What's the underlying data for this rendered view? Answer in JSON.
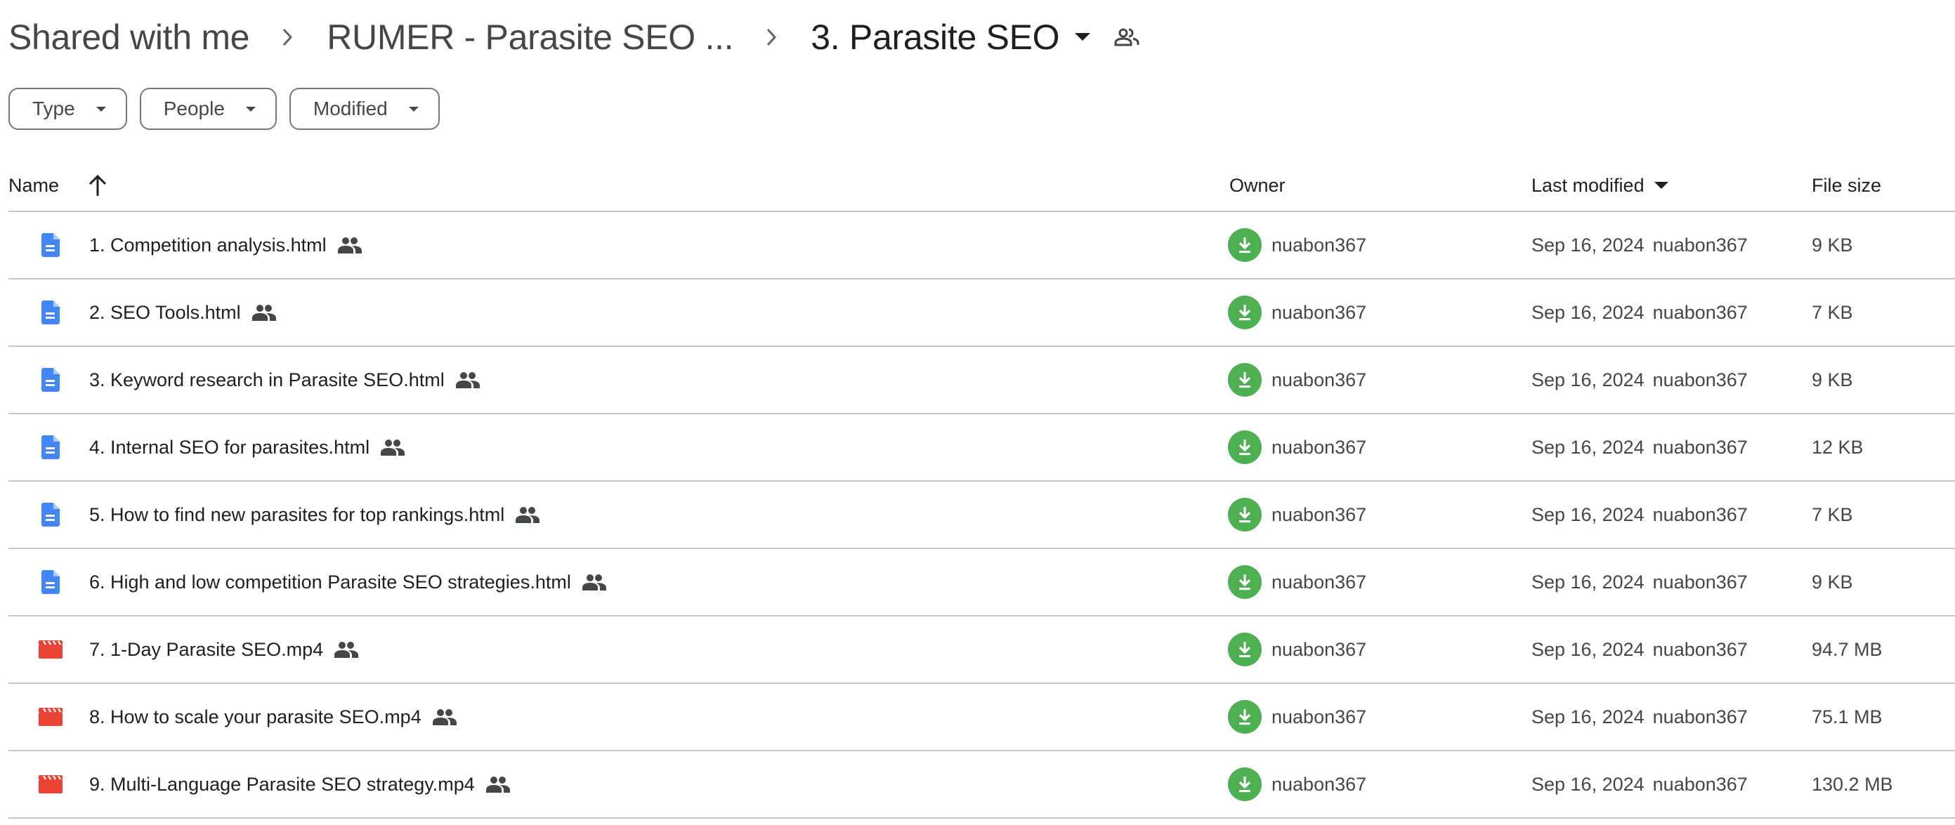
{
  "breadcrumb": {
    "items": [
      {
        "label": "Shared with me"
      },
      {
        "label": "RUMER - Parasite SEO ..."
      },
      {
        "label": "3. Parasite SEO"
      }
    ],
    "separator_icon": "chevron-right-icon",
    "dropdown_icon": "arrow-drop-down-icon",
    "shared_icon": "people-outline-icon"
  },
  "filters": [
    {
      "label": "Type"
    },
    {
      "label": "People"
    },
    {
      "label": "Modified"
    }
  ],
  "table": {
    "columns": {
      "name": "Name",
      "owner": "Owner",
      "last_modified": "Last modified",
      "file_size": "File size"
    },
    "sort": {
      "column": "name",
      "direction": "ascending"
    },
    "rows": [
      {
        "type": "document",
        "name": "1. Competition analysis.html",
        "shared": true,
        "owner": "nuabon367",
        "modified_date": "Sep 16, 2024",
        "modified_by": "nuabon367",
        "size": "9 KB"
      },
      {
        "type": "document",
        "name": "2. SEO Tools.html",
        "shared": true,
        "owner": "nuabon367",
        "modified_date": "Sep 16, 2024",
        "modified_by": "nuabon367",
        "size": "7 KB"
      },
      {
        "type": "document",
        "name": "3. Keyword research in Parasite SEO.html",
        "shared": true,
        "owner": "nuabon367",
        "modified_date": "Sep 16, 2024",
        "modified_by": "nuabon367",
        "size": "9 KB"
      },
      {
        "type": "document",
        "name": "4. Internal SEO for parasites.html",
        "shared": true,
        "owner": "nuabon367",
        "modified_date": "Sep 16, 2024",
        "modified_by": "nuabon367",
        "size": "12 KB"
      },
      {
        "type": "document",
        "name": "5. How to find new parasites for top rankings.html",
        "shared": true,
        "owner": "nuabon367",
        "modified_date": "Sep 16, 2024",
        "modified_by": "nuabon367",
        "size": "7 KB"
      },
      {
        "type": "document",
        "name": "6. High and low competition Parasite SEO strategies.html",
        "shared": true,
        "owner": "nuabon367",
        "modified_date": "Sep 16, 2024",
        "modified_by": "nuabon367",
        "size": "9 KB"
      },
      {
        "type": "video",
        "name": "7. 1-Day Parasite SEO.mp4",
        "shared": true,
        "owner": "nuabon367",
        "modified_date": "Sep 16, 2024",
        "modified_by": "nuabon367",
        "size": "94.7 MB"
      },
      {
        "type": "video",
        "name": "8. How to scale your parasite SEO.mp4",
        "shared": true,
        "owner": "nuabon367",
        "modified_date": "Sep 16, 2024",
        "modified_by": "nuabon367",
        "size": "75.1 MB"
      },
      {
        "type": "video",
        "name": "9. Multi-Language Parasite SEO strategy.mp4",
        "shared": true,
        "owner": "nuabon367",
        "modified_date": "Sep 16, 2024",
        "modified_by": "nuabon367",
        "size": "130.2 MB"
      }
    ]
  },
  "colors": {
    "document_icon": "#4285f4",
    "video_icon": "#ea4335",
    "owner_avatar": "#4caf50",
    "divider": "#c7c7c7",
    "text_primary": "#1f1f1f",
    "text_secondary": "#444746"
  }
}
